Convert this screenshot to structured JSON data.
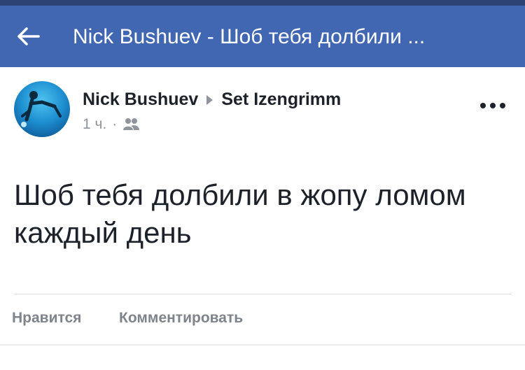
{
  "nav": {
    "title": "Nick Bushuev - Шоб тебя долбили ...",
    "back_icon": "back-arrow-icon"
  },
  "post": {
    "author": "Nick Bushuev",
    "target": "Set Izengrimm",
    "time": "1 ч.",
    "separator": "·",
    "audience_icon": "friends-icon",
    "text": "Шоб тебя долбили в жопу ломом каждый день",
    "more_icon": "more-dots-icon"
  },
  "actions": {
    "like": "Нравится",
    "comment": "Комментировать"
  },
  "colors": {
    "nav_bar": "#4267b2",
    "status_strip": "#2d4373",
    "text_primary": "#1d2129",
    "text_secondary": "#90949c",
    "action_text": "#7f848c"
  }
}
